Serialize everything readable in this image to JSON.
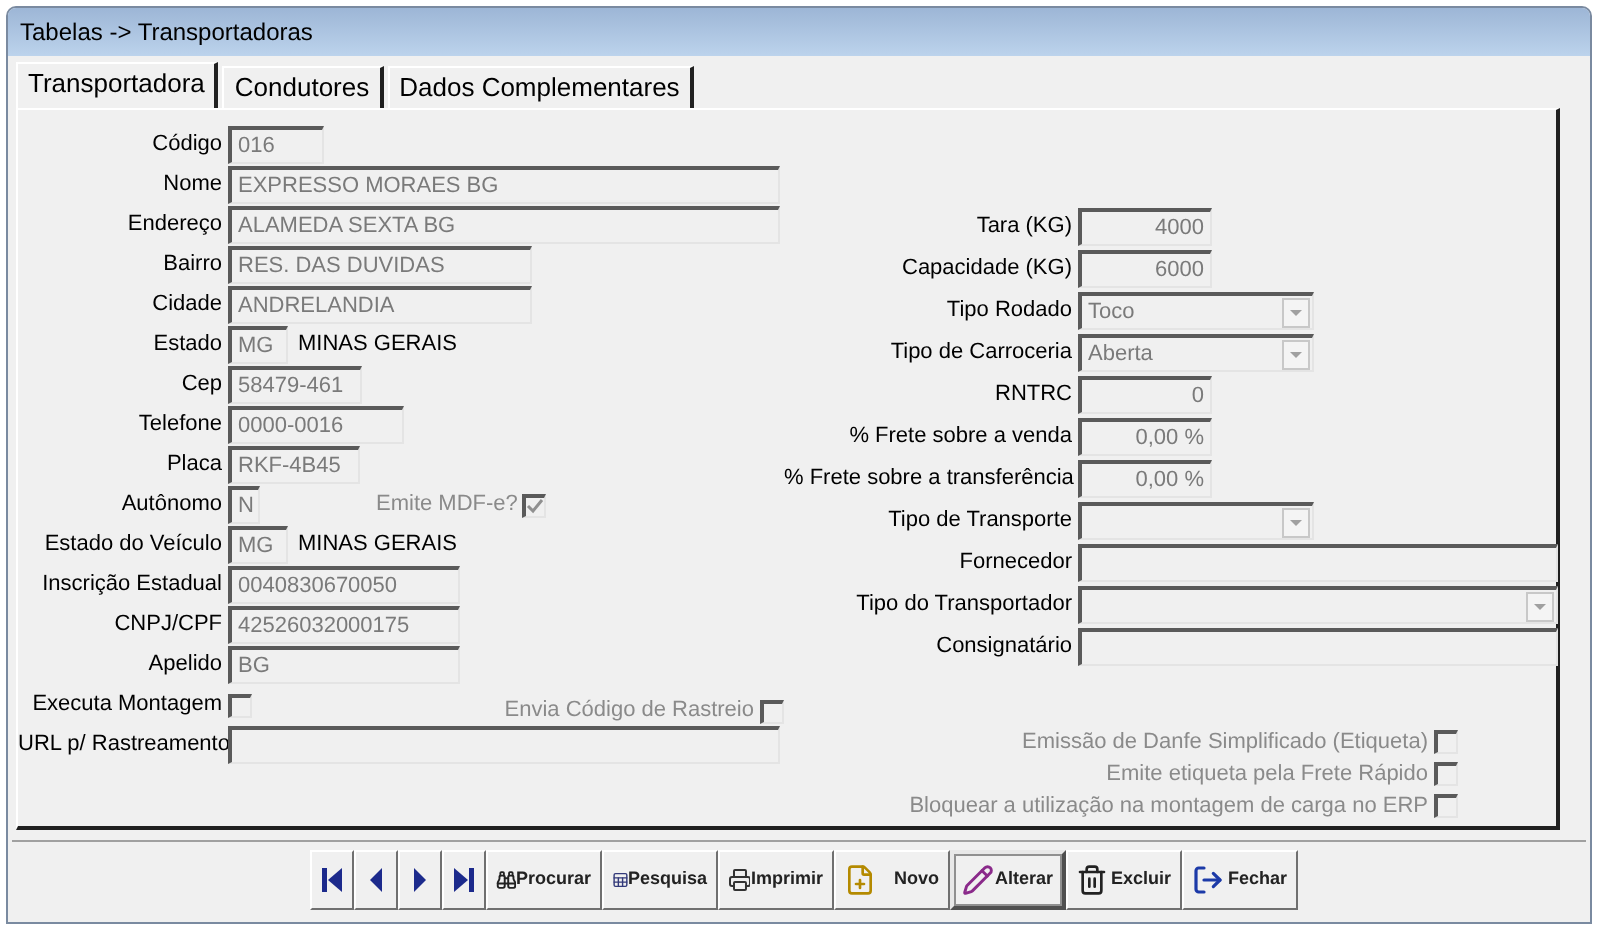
{
  "window": {
    "title": "Tabelas -> Transportadoras"
  },
  "tabs": [
    {
      "label": "Transportadora",
      "selected": true
    },
    {
      "label": "Condutores",
      "selected": false
    },
    {
      "label": "Dados Complementares",
      "selected": false
    }
  ],
  "left_fields": [
    {
      "kind": "text",
      "label": "Código",
      "value": "016"
    },
    {
      "kind": "text",
      "label": "Nome",
      "value": "EXPRESSO MORAES BG"
    },
    {
      "kind": "text",
      "label": "Endereço",
      "value": "ALAMEDA SEXTA BG"
    },
    {
      "kind": "text",
      "label": "Bairro",
      "value": "RES. DAS DUVIDAS"
    },
    {
      "kind": "text",
      "label": "Cidade",
      "value": "ANDRELANDIA"
    },
    {
      "kind": "state",
      "label": "Estado",
      "value": "MG",
      "description": "MINAS GERAIS"
    },
    {
      "kind": "text",
      "label": "Cep",
      "value": "58479-461"
    },
    {
      "kind": "text",
      "label": "Telefone",
      "value": "0000-0016"
    },
    {
      "kind": "text",
      "label": "Placa",
      "value": "RKF-4B45"
    },
    {
      "kind": "text_check",
      "label": "Autônomo",
      "value": "N",
      "option": {
        "label": "Emite MDF-e?",
        "checked": true,
        "disabled": true
      }
    },
    {
      "kind": "state",
      "label": "Estado do Veículo",
      "value": "MG",
      "description": "MINAS GERAIS"
    },
    {
      "kind": "text",
      "label": "Inscrição Estadual",
      "value": "0040830670050"
    },
    {
      "kind": "text",
      "label": "CNPJ/CPF",
      "value": "42526032000175"
    },
    {
      "kind": "text",
      "label": "Apelido",
      "value": "BG"
    },
    {
      "kind": "check",
      "label": "Executa Montagem",
      "checked": false,
      "option": {
        "label": "Envia Código de Rastreio",
        "checked": false,
        "disabled": true
      }
    },
    {
      "kind": "text",
      "label": "URL p/ Rastreamento"
    }
  ],
  "right_fields": [
    {
      "kind": "number",
      "label": "Tara (KG)",
      "value": "4000"
    },
    {
      "kind": "number",
      "label": "Capacidade (KG)",
      "value": "6000"
    },
    {
      "kind": "combo",
      "label": "Tipo Rodado",
      "value": "Toco"
    },
    {
      "kind": "combo",
      "label": "Tipo de Carroceria",
      "value": "Aberta"
    },
    {
      "kind": "number",
      "label": "RNTRC",
      "value": "0"
    },
    {
      "kind": "number",
      "label": "% Frete sobre a venda",
      "value": "0,00 %"
    },
    {
      "kind": "number",
      "label": "% Frete sobre a transferência",
      "value": "0,00 %"
    },
    {
      "kind": "combo",
      "label": "Tipo de Transporte"
    },
    {
      "kind": "text",
      "label": "Fornecedor"
    },
    {
      "kind": "combo",
      "label": "Tipo do Transportador"
    },
    {
      "kind": "text",
      "label": "Consignatário"
    }
  ],
  "options": [
    {
      "label": "Emissão de Danfe Simplificado (Etiqueta)",
      "checked": false,
      "disabled": true
    },
    {
      "label": "Emite etiqueta pela Frete Rápido",
      "checked": false,
      "disabled": true
    },
    {
      "label": "Bloquear a utilização na montagem de carga no ERP",
      "checked": false,
      "disabled": true
    }
  ],
  "toolbar": [
    {
      "kind": "first",
      "focused": false
    },
    {
      "kind": "prev",
      "focused": false
    },
    {
      "kind": "next",
      "focused": false
    },
    {
      "kind": "last",
      "focused": false
    },
    {
      "kind": "action",
      "label": "Procurar",
      "focused": false
    },
    {
      "kind": "action",
      "label": "Pesquisa",
      "focused": false
    },
    {
      "kind": "action",
      "label": "Imprimir",
      "focused": false
    },
    {
      "kind": "action",
      "label": "Novo",
      "focused": false
    },
    {
      "kind": "action",
      "label": "Alterar",
      "focused": true
    },
    {
      "kind": "action",
      "label": "Excluir",
      "focused": false
    },
    {
      "kind": "action",
      "label": "Fechar",
      "focused": false
    }
  ]
}
